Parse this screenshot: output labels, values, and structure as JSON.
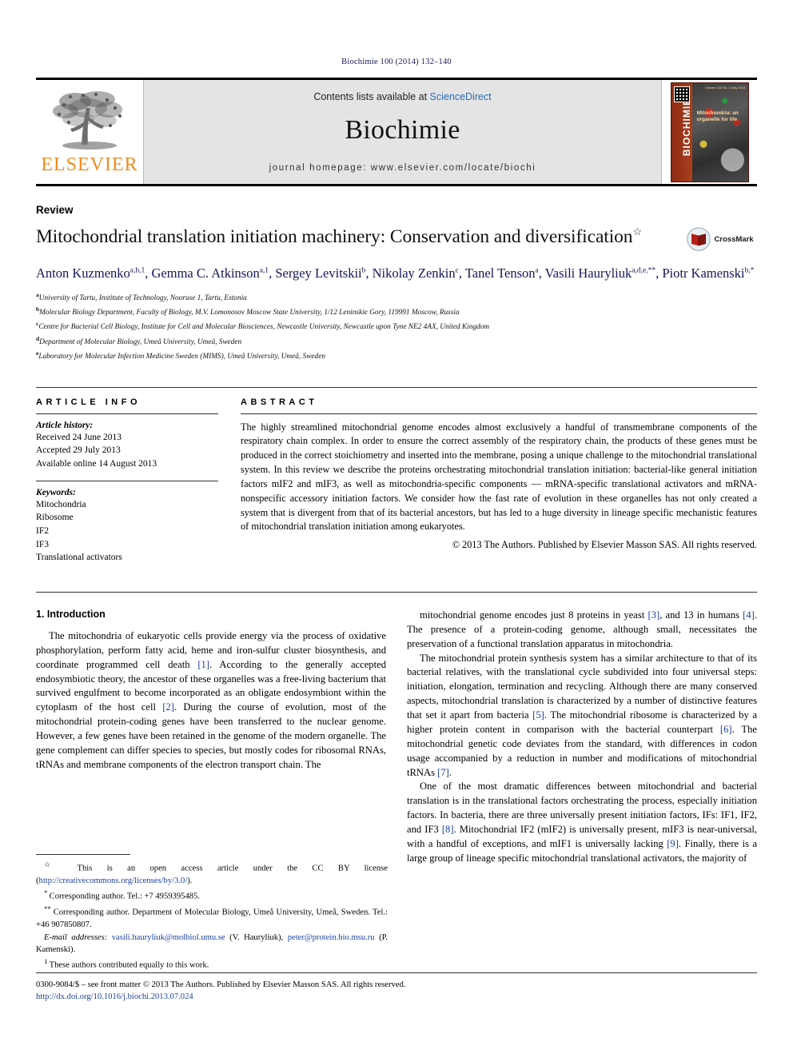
{
  "running_head": "Biochimie 100 (2014) 132–140",
  "masthead": {
    "publisher_logo_label": "ELSEVIER",
    "contents_prefix": "Contents lists available at ",
    "contents_link": "ScienceDirect",
    "journal_name": "Biochimie",
    "homepage": "journal homepage: www.elsevier.com/locate/biochi",
    "cover": {
      "spine_title": "BIOCHIMIE",
      "caption": "Mitochondria: an organelle for life",
      "corner_note": "Volume 100  No. 1\nMay 2014"
    }
  },
  "article": {
    "doctype": "Review",
    "title": "Mitochondrial translation initiation machinery: Conservation and diversification",
    "title_marker": "☆",
    "crossmark_label": "CrossMark",
    "authors": [
      {
        "name": "Anton Kuzmenko",
        "sup": "a,b,1",
        "sep": ", "
      },
      {
        "name": "Gemma C. Atkinson",
        "sup": "a,1",
        "sep": ", "
      },
      {
        "name": "Sergey Levitskii",
        "sup": "b",
        "sep": ", "
      },
      {
        "name": "Nikolay Zenkin",
        "sup": "c",
        "sep": ", "
      },
      {
        "name": "Tanel Tenson",
        "sup": "a",
        "sep": ", "
      },
      {
        "name": "Vasili Hauryliuk",
        "sup": "a,d,e,**",
        "sep": ", "
      },
      {
        "name": "Piotr Kamenski",
        "sup": "b,*",
        "sep": ""
      }
    ],
    "affiliations": [
      {
        "mark": "a",
        "text": "University of Tartu, Institute of Technology, Nooruse 1, Tartu, Estonia"
      },
      {
        "mark": "b",
        "text": "Molecular Biology Department, Faculty of Biology, M.V. Lomonosov Moscow State University, 1/12 Leninskie Gory, 119991 Moscow, Russia"
      },
      {
        "mark": "c",
        "text": "Centre for Bacterial Cell Biology, Institute for Cell and Molecular Biosciences, Newcastle University, Newcastle upon Tyne NE2 4AX, United Kingdom"
      },
      {
        "mark": "d",
        "text": "Department of Molecular Biology, Umeå University, Umeå, Sweden"
      },
      {
        "mark": "e",
        "text": "Laboratory for Molecular Infection Medicine Sweden (MIMS), Umeå University, Umeå, Sweden"
      }
    ]
  },
  "article_info": {
    "heading": "ARTICLE INFO",
    "history_label": "Article history:",
    "history": [
      "Received 24 June 2013",
      "Accepted 29 July 2013",
      "Available online 14 August 2013"
    ],
    "keywords_label": "Keywords:",
    "keywords": [
      "Mitochondria",
      "Ribosome",
      "IF2",
      "IF3",
      "Translational activators"
    ]
  },
  "abstract": {
    "heading": "ABSTRACT",
    "text": "The highly streamlined mitochondrial genome encodes almost exclusively a handful of transmembrane components of the respiratory chain complex. In order to ensure the correct assembly of the respiratory chain, the products of these genes must be produced in the correct stoichiometry and inserted into the membrane, posing a unique challenge to the mitochondrial translational system. In this review we describe the proteins orchestrating mitochondrial translation initiation: bacterial-like general initiation factors mIF2 and mIF3, as well as mitochondria-specific components — mRNA-specific translational activators and mRNA-nonspecific accessory initiation factors. We consider how the fast rate of evolution in these organelles has not only created a system that is divergent from that of its bacterial ancestors, but has led to a huge diversity in lineage specific mechanistic features of mitochondrial translation initiation among eukaryotes.",
    "copyright": "© 2013 The Authors. Published by Elsevier Masson SAS. All rights reserved."
  },
  "body": {
    "section_heading": "1. Introduction",
    "left_paragraphs": [
      "The mitochondria of eukaryotic cells provide energy via the process of oxidative phosphorylation, perform fatty acid, heme and iron-sulfur cluster biosynthesis, and coordinate programmed cell death [1]. According to the generally accepted endosymbiotic theory, the ancestor of these organelles was a free-living bacterium that survived engulfment to become incorporated as an obligate endosymbiont within the cytoplasm of the host cell [2]. During the course of evolution, most of the mitochondrial protein-coding genes have been transferred to the nuclear genome. However, a few genes have been retained in the genome of the modern organelle. The gene complement can differ species to species, but mostly codes for ribosomal RNAs, tRNAs and membrane components of the electron transport chain. The"
    ],
    "right_paragraphs": [
      "mitochondrial genome encodes just 8 proteins in yeast [3], and 13 in humans [4]. The presence of a protein-coding genome, although small, necessitates the preservation of a functional translation apparatus in mitochondria.",
      "The mitochondrial protein synthesis system has a similar architecture to that of its bacterial relatives, with the translational cycle subdivided into four universal steps: initiation, elongation, termination and recycling. Although there are many conserved aspects, mitochondrial translation is characterized by a number of distinctive features that set it apart from bacteria [5]. The mitochondrial ribosome is characterized by a higher protein content in comparison with the bacterial counterpart [6]. The mitochondrial genetic code deviates from the standard, with differences in codon usage accompanied by a reduction in number and modifications of mitochondrial tRNAs [7].",
      "One of the most dramatic differences between mitochondrial and bacterial translation is in the translational factors orchestrating the process, especially initiation factors. In bacteria, there are three universally present initiation factors, IFs: IF1, IF2, and IF3 [8]. Mitochondrial IF2 (mIF2) is universally present, mIF3 is near-universal, with a handful of exceptions, and mIF1 is universally lacking [9]. Finally, there is a large group of lineage specific mitochondrial translational activators, the majority of"
    ]
  },
  "footnotes": [
    {
      "mark": "☆",
      "text": "This is an open access article under the CC BY license (",
      "link": "http://creativecommons.org/licenses/by/3.0/",
      "tail": ")."
    },
    {
      "mark": "*",
      "text": "Corresponding author. Tel.: +7 4959395485."
    },
    {
      "mark": "**",
      "text": "Corresponding author. Department of Molecular Biology, Umeå University, Umeå, Sweden. Tel.: +46 907850807."
    },
    {
      "mark": "",
      "label": "E-mail addresses:",
      "email1": "vasili.hauryliuk@molbiol.umu.se",
      "owner1": " (V. Hauryliuk), ",
      "email2": "peter@protein.bio.msu.ru",
      "owner2": " (P. Kamenski)."
    },
    {
      "mark": "1",
      "text": "These authors contributed equally to this work."
    }
  ],
  "bottom": {
    "issn_line": "0300-9084/$ – see front matter © 2013 The Authors. Published by Elsevier Masson SAS. All rights reserved.",
    "doi": "http://dx.doi.org/10.1016/j.biochi.2013.07.024"
  },
  "colors": {
    "elsevier_orange": "#F08C1E",
    "link_blue": "#2b6cb5",
    "reference_blue": "#1a3fa0",
    "author_navy": "#16165a",
    "masthead_grey": "#e4e4e4"
  }
}
